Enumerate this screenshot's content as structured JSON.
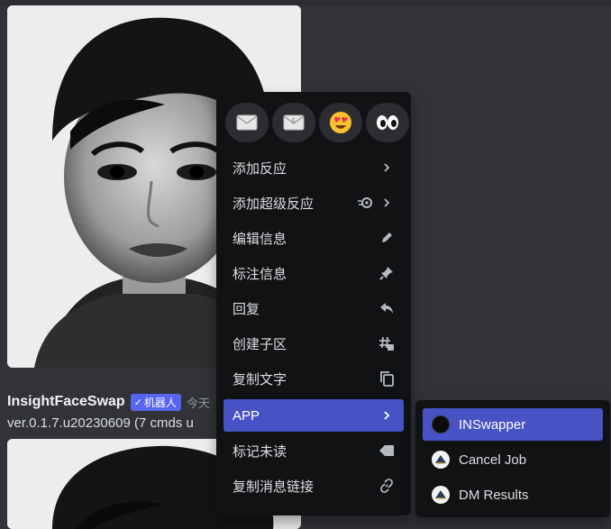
{
  "message": {
    "username": "InsightFaceSwap",
    "bot_tag": "机器人",
    "bot_check": "✓",
    "timestamp": "今天",
    "text": "ver.0.1.7.u20230609 (7 cmds u"
  },
  "reactions": [
    {
      "emoji": "✉️",
      "icon": "envelope-icon"
    },
    {
      "emoji": "📨",
      "icon": "incoming-envelope-icon"
    },
    {
      "emoji": "😍",
      "icon": "heart-eyes-icon"
    },
    {
      "emoji": "👀",
      "icon": "eyes-icon"
    }
  ],
  "menu": {
    "items": [
      {
        "label": "添加反应",
        "icon": "chevron-right-icon"
      },
      {
        "label": "添加超级反应",
        "icon": "super-reaction-icon"
      },
      {
        "label": "编辑信息",
        "icon": "pencil-icon"
      },
      {
        "label": "标注信息",
        "icon": "pin-icon"
      },
      {
        "label": "回复",
        "icon": "reply-icon"
      },
      {
        "label": "创建子区",
        "icon": "thread-icon"
      },
      {
        "label": "复制文字",
        "icon": "copy-icon"
      },
      {
        "label": "APP",
        "icon": "chevron-right-icon",
        "active": true
      },
      {
        "label": "标记未读",
        "icon": "unread-tag-icon"
      },
      {
        "label": "复制消息链接",
        "icon": "link-icon"
      }
    ]
  },
  "submenu": {
    "items": [
      {
        "label": "INSwapper",
        "icon": "inswapper-avatar-icon",
        "active": true
      },
      {
        "label": "Cancel Job",
        "icon": "app-avatar-icon"
      },
      {
        "label": "DM Results",
        "icon": "app-avatar-icon"
      }
    ]
  },
  "colors": {
    "accent": "#4752c4",
    "menu_bg": "#111214",
    "chat_bg": "#313338",
    "brand": "#5865f2"
  }
}
